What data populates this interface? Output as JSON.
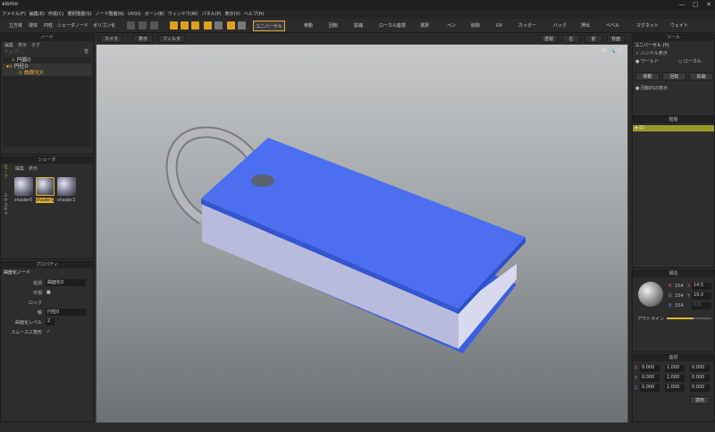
{
  "app": {
    "title": "xismo",
    "window_buttons": [
      "—",
      "▢",
      "✕"
    ]
  },
  "menu": [
    "ファイル(F)",
    "編集(E)",
    "作成(C)",
    "選択階層(S)",
    "ノード階層(N)",
    "UV(U)",
    "ボーン(B)",
    "ウィンドウ(W)",
    "パネル(P)",
    "表示(V)",
    "ヘルプ(H)"
  ],
  "toolbar": {
    "items": [
      "立方体",
      "球体",
      "円柱",
      "シェーダノード",
      "ポリゴン化"
    ],
    "universal": "ユニバーサル",
    "move": "移動",
    "rotate": "回転",
    "scale": "拡縮",
    "local": "ローカル座標",
    "select": "選択",
    "pen": "ペン",
    "knife": "削除",
    "uv": "UV",
    "cutter": "カッター",
    "bake": "バック",
    "push": "押出",
    "bevel": "ベベル",
    "magnet": "マグネット",
    "weight": "ウェイト"
  },
  "node_panel": {
    "header": "ノード",
    "tabs": [
      "編集",
      "表示",
      "タグ"
    ],
    "items": [
      {
        "label": "円錐0",
        "depth": 0
      },
      {
        "label": "円柱0",
        "depth": 0
      },
      {
        "label": "曲面化0",
        "depth": 1
      }
    ]
  },
  "shader_panel": {
    "header": "シェーダ",
    "side_tabs": [
      "モーフ",
      "テクスチャ"
    ],
    "tabs": [
      "編集",
      "表示"
    ],
    "items": [
      "shader0",
      "shader1",
      "shader2"
    ]
  },
  "property_panel": {
    "header": "プロパティ",
    "title": "曲面化ノード",
    "rows": [
      {
        "label": "名前",
        "value": "曲面化0"
      },
      {
        "label": "可視",
        "value": "■"
      },
      {
        "label": "ロック",
        "value": ""
      },
      {
        "label": "鏡",
        "value": "円柱0"
      },
      {
        "label": "曲面化レベル",
        "value": "2"
      },
      {
        "label": "スムース三角形",
        "value": "✓"
      }
    ]
  },
  "viewport": {
    "tabs": [
      "カメラ",
      "表示",
      "フィルタ"
    ],
    "right_buttons": [
      "透視",
      "右",
      "前",
      "背面"
    ],
    "nav_icons": "✛ 🔍 ▢"
  },
  "tool_panel": {
    "header": "ツール",
    "title": "ユニバーサル (Y)",
    "handle_label": "ハンドル表示",
    "world": "ワールド",
    "local": "ローカル",
    "buttons": [
      "移動",
      "回転",
      "拡縮"
    ],
    "snap_label": "回転円の表示"
  },
  "layer_panel": {
    "header": "階層",
    "item": "ロ"
  },
  "material_panel": {
    "header": "構造",
    "r_label": "R",
    "g_label": "G",
    "b_label": "B",
    "r": "154",
    "g": "154",
    "b": "154",
    "x_label": "X",
    "y_label": "Y",
    "x": "14.5",
    "y": "19.0",
    "z": "0.0",
    "outline": "アウトライン"
  },
  "transform_panel": {
    "header": "座標",
    "rows": [
      [
        "0.000",
        "1.000",
        "0.000"
      ],
      [
        "0.000",
        "1.000",
        "0.000"
      ],
      [
        "0.000",
        "1.000",
        "0.000"
      ]
    ],
    "axes": [
      "X",
      "Y",
      "Z"
    ],
    "apply": "適用"
  },
  "colors": {
    "accent": "#e0b030",
    "book_cover": "#4b6ff0",
    "book_pages": "#b6b8da",
    "ring": "#a8aab0"
  }
}
